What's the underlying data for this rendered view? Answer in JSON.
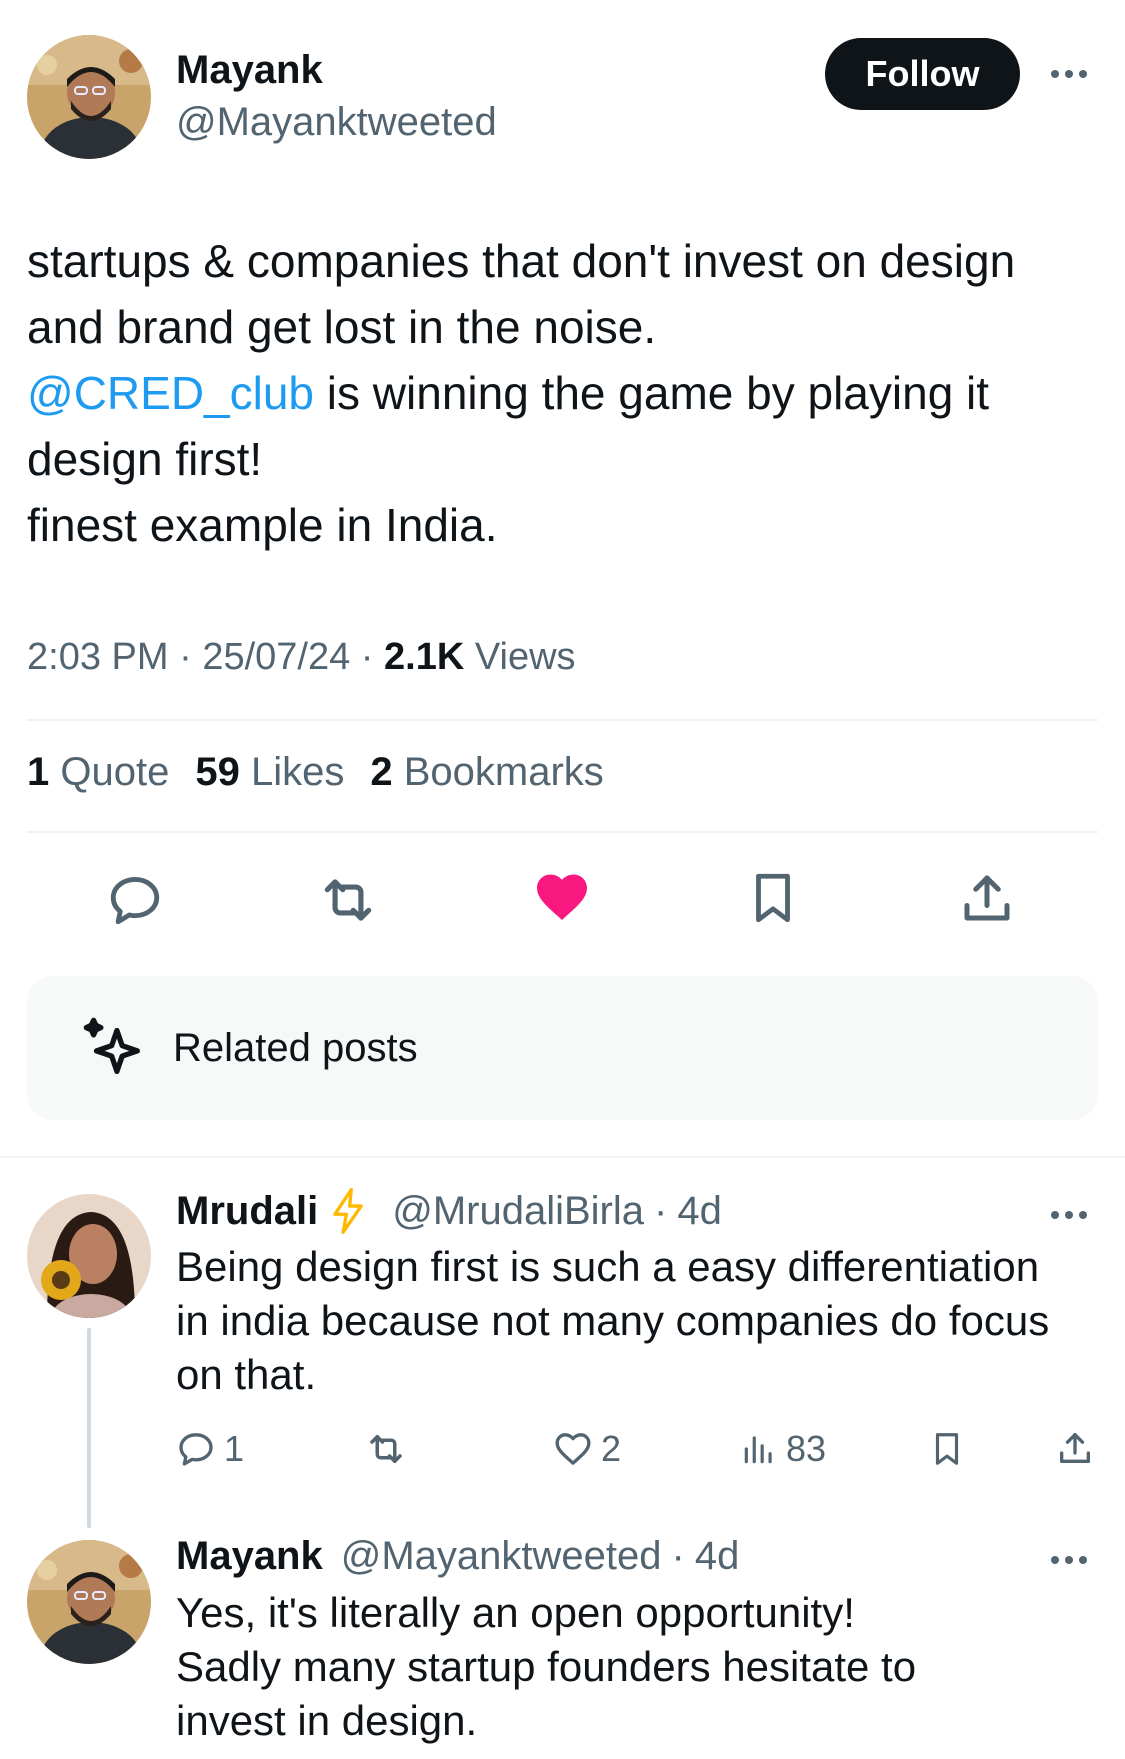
{
  "tweet": {
    "author_name": "Mayank",
    "author_handle": "@Mayanktweeted",
    "follow_label": "Follow",
    "text_line1": "startups & companies that don't invest on design",
    "text_line2": "and brand get lost in the noise.",
    "mention": "@CRED_club",
    "text_line3_rest": " is winning the game by playing it",
    "text_line4": "design first!",
    "text_line5": "finest example in India.",
    "time": "2:03 PM",
    "date": "25/07/24",
    "views_count": "2.1K",
    "views_label": "Views",
    "separator": "·"
  },
  "stats": {
    "quotes_count": "1",
    "quotes_label": "Quote",
    "likes_count": "59",
    "likes_label": "Likes",
    "bookmarks_count": "2",
    "bookmarks_label": "Bookmarks"
  },
  "actions": {
    "reply_icon": "reply-icon",
    "retweet_icon": "retweet-icon",
    "like_icon": "heart-filled-icon",
    "bookmark_icon": "bookmark-icon",
    "share_icon": "share-icon",
    "like_color": "#f91880"
  },
  "related": {
    "label": "Related posts",
    "icon": "sparkle-icon"
  },
  "replies": [
    {
      "name": "Mrudali",
      "badge_icon": "lightning-icon",
      "handle": "@MrudaliBirla",
      "age": "4d",
      "line1": "Being design first is such a easy differentiation",
      "line2": "in india because not many companies do focus",
      "line3": "on that.",
      "reply_count": "1",
      "like_count": "2",
      "views_count": "83"
    },
    {
      "name": "Mayank",
      "handle": "@Mayanktweeted",
      "age": "4d",
      "line1": "Yes, it's literally an open opportunity!",
      "line2": "Sadly many startup founders hesitate to",
      "line3": "invest in design."
    }
  ],
  "colors": {
    "text": "#0f1419",
    "secondary": "#536471",
    "link": "#1d9bf0",
    "like": "#f91880",
    "divider": "#eff3f4",
    "lightning": "#ffb800"
  }
}
